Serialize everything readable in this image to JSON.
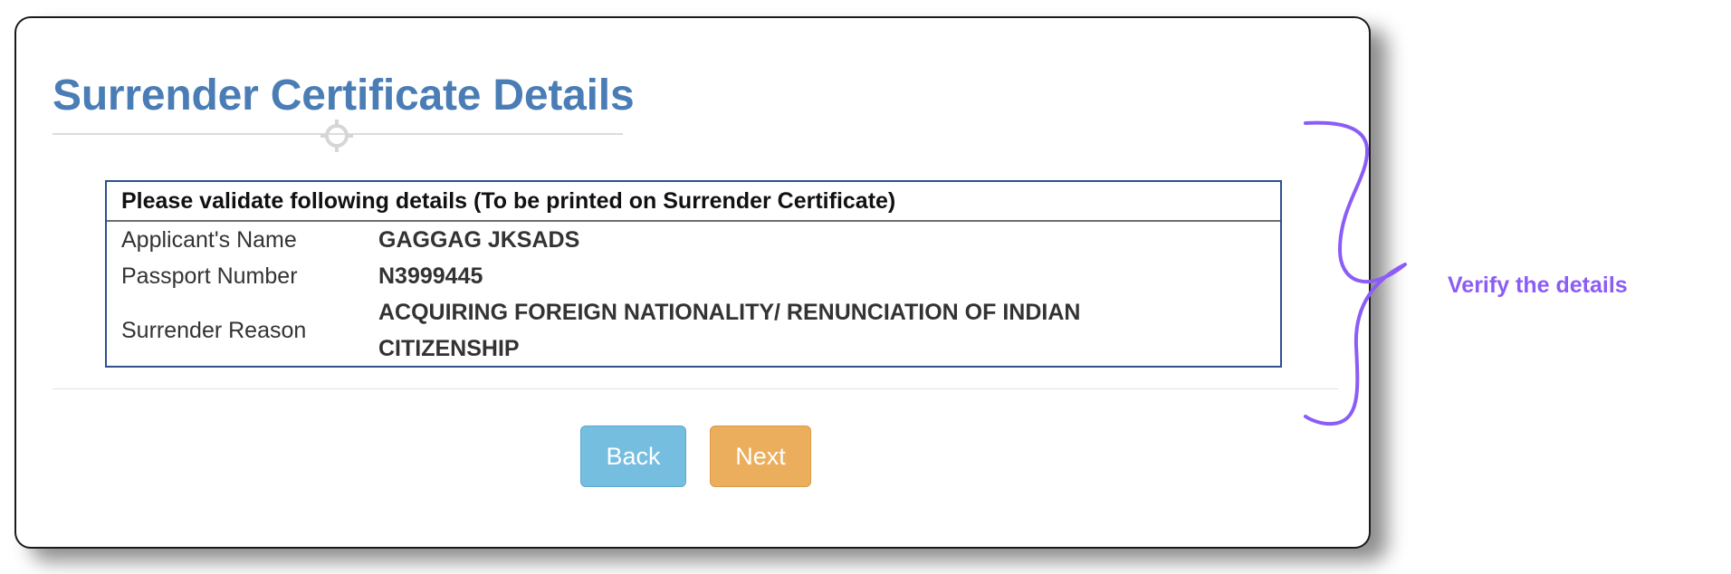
{
  "page": {
    "title": "Surrender Certificate Details"
  },
  "details": {
    "header": "Please validate following details (To be printed on Surrender Certificate)",
    "rows": [
      {
        "label": "Applicant's Name",
        "value": "GAGGAG JKSADS"
      },
      {
        "label": "Passport Number",
        "value": "N3999445"
      },
      {
        "label": "Surrender Reason",
        "value": "ACQUIRING FOREIGN NATIONALITY/ RENUNCIATION OF INDIAN CITIZENSHIP"
      }
    ]
  },
  "buttons": {
    "back_label": "Back",
    "next_label": "Next"
  },
  "annotation": {
    "text": "Verify the details",
    "color": "#8b5cf6"
  },
  "colors": {
    "title": "#4a7db5",
    "box_border": "#2f4f8f",
    "back_button": "#76bedf",
    "next_button": "#eaae5c"
  },
  "icons": {
    "title_rule_ornament": "crosshair-icon",
    "annotation_brace": "curly-brace-icon"
  }
}
